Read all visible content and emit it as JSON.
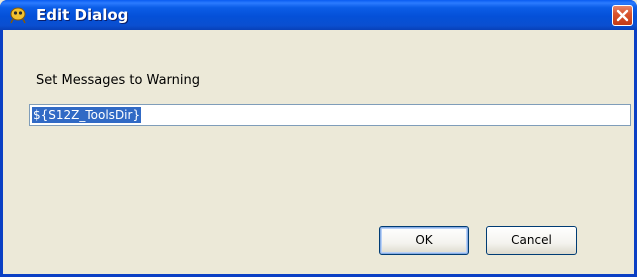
{
  "window": {
    "title": "Edit Dialog",
    "icon": "app-icon",
    "close_icon": "close-icon"
  },
  "dialog": {
    "label": "Set Messages to Warning",
    "value": "${S12Z_ToolsDir}"
  },
  "buttons": {
    "ok": "OK",
    "cancel": "Cancel"
  },
  "colors": {
    "titlebar": "#0450D8",
    "selection": "#316AC5",
    "close_button": "#D9552F",
    "client": "#ECE9D8"
  }
}
